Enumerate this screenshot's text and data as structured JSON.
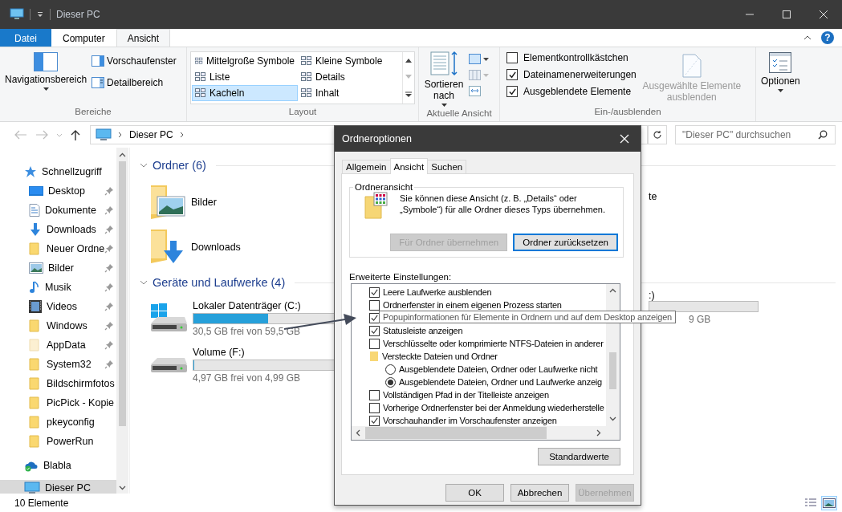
{
  "window": {
    "title": "Dieser PC"
  },
  "ribbon_tabs": [
    {
      "label": "Datei",
      "kind": "file",
      "selected": false
    },
    {
      "label": "Computer",
      "kind": "tab",
      "selected": false
    },
    {
      "label": "Ansicht",
      "kind": "tab",
      "selected": true
    }
  ],
  "help": "?",
  "ribbon": {
    "panes": {
      "label": "Bereiche",
      "navigation": "Navigationsbereich",
      "preview": "Vorschaufenster",
      "details": "Detailbereich"
    },
    "layout": {
      "label": "Layout",
      "options": [
        {
          "label": "Mittelgroße Symbole",
          "selected": false
        },
        {
          "label": "Kleine Symbole",
          "selected": false
        },
        {
          "label": "Liste",
          "selected": false
        },
        {
          "label": "Details",
          "selected": false
        },
        {
          "label": "Kacheln",
          "selected": true
        },
        {
          "label": "Inhalt",
          "selected": false
        }
      ]
    },
    "current_view": {
      "label": "Aktuelle Ansicht",
      "sort": "Sortieren nach"
    },
    "show_hide": {
      "label": "Ein-/ausblenden",
      "checkboxes": [
        {
          "label": "Elementkontrollkästchen",
          "checked": false
        },
        {
          "label": "Dateinamenerweiterungen",
          "checked": true
        },
        {
          "label": "Ausgeblendete Elemente",
          "checked": true
        }
      ],
      "hide_selected": {
        "label": "Ausgewählte Elemente ausblenden",
        "disabled": true
      }
    },
    "options": {
      "label": "Optionen"
    }
  },
  "address": {
    "path": "Dieser PC",
    "search_placeholder": "\"Dieser PC\" durchsuchen"
  },
  "nav": [
    {
      "label": "Schnellzugriff",
      "kind": "star",
      "selected": false,
      "children": [
        {
          "label": "Desktop",
          "kind": "desktop",
          "pinned": true,
          "selected": false
        },
        {
          "label": "Dokumente",
          "kind": "document",
          "pinned": true,
          "selected": false
        },
        {
          "label": "Downloads",
          "kind": "download",
          "pinned": true,
          "selected": false
        },
        {
          "label": "Neuer Ordne",
          "kind": "folder",
          "pinned": true,
          "selected": false
        },
        {
          "label": "Bilder",
          "kind": "picture",
          "pinned": true,
          "selected": false
        },
        {
          "label": "Musik",
          "kind": "music",
          "pinned": true,
          "selected": false
        },
        {
          "label": "Videos",
          "kind": "video",
          "pinned": true,
          "selected": false
        },
        {
          "label": "Windows",
          "kind": "folder",
          "pinned": true,
          "selected": false
        },
        {
          "label": "AppData",
          "kind": "folder-pale",
          "pinned": true,
          "selected": false
        },
        {
          "label": "System32",
          "kind": "folder",
          "pinned": true,
          "selected": false
        },
        {
          "label": "Bildschirmfotos",
          "kind": "folder",
          "pinned": false,
          "selected": false
        },
        {
          "label": "PicPick - Kopie",
          "kind": "folder",
          "pinned": false,
          "selected": false
        },
        {
          "label": "pkeyconfig",
          "kind": "folder",
          "pinned": false,
          "selected": false
        },
        {
          "label": "PowerRun",
          "kind": "folder",
          "pinned": false,
          "selected": false
        }
      ]
    },
    {
      "label": "Blabla",
      "kind": "cloud",
      "selected": false
    },
    {
      "label": "Dieser PC",
      "kind": "computer",
      "selected": true
    }
  ],
  "folders": {
    "title": "Ordner (6)",
    "expanded": true,
    "items": [
      {
        "label": "Bilder",
        "kind": "pictures"
      },
      {
        "label": "Downloads",
        "kind": "downloads"
      },
      {
        "label": "te",
        "kind": "partial"
      }
    ]
  },
  "drives": {
    "title": "Geräte und Laufwerke (4)",
    "expanded": true,
    "items": [
      {
        "name": "Lokaler Datenträger (C:)",
        "kind": "system",
        "level": 0.49,
        "free": "30,5 GB frei von 59,5 GB"
      },
      {
        "name": "Volume (F:)",
        "kind": "drive",
        "level": 0.004,
        "free": "4,97 GB frei von 4,99 GB"
      },
      {
        "name": ":)",
        "kind": "partial",
        "free": "9 GB"
      }
    ]
  },
  "status_bar": {
    "count": "10 Elemente",
    "views": [
      {
        "kind": "details",
        "selected": false
      },
      {
        "kind": "tiles",
        "selected": true
      }
    ]
  },
  "dialog": {
    "title": "Ordneroptionen",
    "tabs": [
      {
        "label": "Allgemein",
        "selected": false
      },
      {
        "label": "Ansicht",
        "selected": true
      },
      {
        "label": "Suchen",
        "selected": false
      }
    ],
    "group": {
      "title": "Ordneransicht",
      "text": "Sie können diese Ansicht (z. B. „Details“ oder „Symbole“) für alle Ordner dieses Typs übernehmen.",
      "buttons": [
        {
          "label": "Für Ordner übernehmen",
          "disabled": true,
          "default": false
        },
        {
          "label": "Ordner zurücksetzen",
          "disabled": false,
          "default": true
        }
      ]
    },
    "advanced_label": "Erweiterte Einstellungen:",
    "settings": [
      {
        "kind": "checkbox",
        "label": "Leere Laufwerke ausblenden",
        "checked": true
      },
      {
        "kind": "checkbox",
        "label": "Ordnerfenster in einem eigenen Prozess starten",
        "checked": false
      },
      {
        "kind": "checkbox",
        "checked": true
      },
      {
        "kind": "checkbox",
        "label": "Statusleiste anzeigen",
        "checked": true
      },
      {
        "kind": "checkbox",
        "label": "Verschlüsselte oder komprimierte NTFS-Dateien in anderer",
        "checked": false
      },
      {
        "kind": "folder",
        "label": "Versteckte Dateien und Ordner",
        "children": [
          {
            "kind": "radio",
            "label": "Ausgeblendete Dateien, Ordner oder Laufwerke nicht",
            "selected": false
          },
          {
            "kind": "radio",
            "label": "Ausgeblendete Dateien, Ordner und Laufwerke anzeig",
            "selected": true
          }
        ]
      },
      {
        "kind": "checkbox",
        "label": "Vollständigen Pfad in der Titelleiste anzeigen",
        "checked": false
      },
      {
        "kind": "checkbox",
        "label": "Vorherige Ordnerfenster bei der Anmeldung wiederherstelle",
        "checked": false
      },
      {
        "kind": "checkbox",
        "label": "Vorschauhandler im Vorschaufenster anzeigen",
        "checked": true
      }
    ],
    "tooltip": "Popupinformationen für Elemente in Ordnern und auf dem Desktop anzeigen",
    "defaults_button": "Standardwerte",
    "buttons": [
      {
        "label": "OK",
        "disabled": false
      },
      {
        "label": "Abbrechen",
        "disabled": false
      },
      {
        "label": "Übernehmen",
        "disabled": true
      }
    ]
  }
}
